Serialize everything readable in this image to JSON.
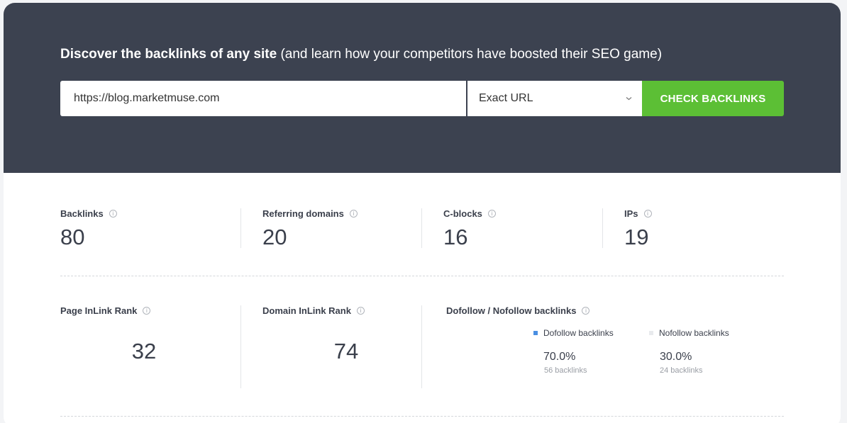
{
  "header": {
    "headline_bold": "Discover the backlinks of any site",
    "headline_rest": "(and learn how your competitors have boosted their SEO game)"
  },
  "search": {
    "url_value": "https://blog.marketmuse.com",
    "mode_selected": "Exact URL",
    "submit_label": "CHECK BACKLINKS"
  },
  "stats": {
    "backlinks": {
      "label": "Backlinks",
      "value": "80"
    },
    "referring_domains": {
      "label": "Referring domains",
      "value": "20"
    },
    "c_blocks": {
      "label": "C-blocks",
      "value": "16"
    },
    "ips": {
      "label": "IPs",
      "value": "19"
    }
  },
  "ranks": {
    "page_inlink": {
      "label": "Page InLink Rank",
      "value": "32"
    },
    "domain_inlink": {
      "label": "Domain InLink Rank",
      "value": "74"
    }
  },
  "follow": {
    "title": "Dofollow / Nofollow backlinks",
    "dofollow": {
      "label": "Dofollow backlinks",
      "percent": "70.0%",
      "count": "56 backlinks",
      "color": "#4a8fe2"
    },
    "nofollow": {
      "label": "Nofollow backlinks",
      "percent": "30.0%",
      "count": "24 backlinks",
      "color": "#e8eaed"
    }
  },
  "icons": {
    "info": "i",
    "chevron": "chevron-down-icon"
  },
  "colors": {
    "hero_bg": "#3c4250",
    "button_green": "#5cbf35"
  }
}
